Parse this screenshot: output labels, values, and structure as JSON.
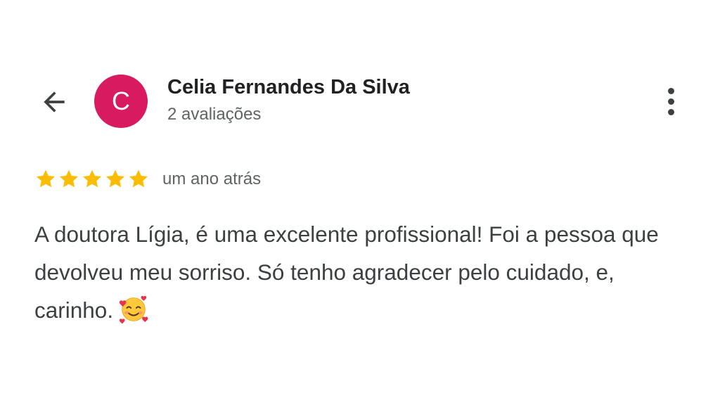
{
  "header": {
    "back_icon": "arrow-left-icon",
    "more_icon": "more-vert-icon"
  },
  "reviewer": {
    "avatar_letter": "C",
    "avatar_color": "#D81B60",
    "name": "Celia Fernandes Da Silva",
    "review_count": "2 avaliações"
  },
  "review": {
    "rating": 5,
    "max_rating": 5,
    "star_color": "#FBBC04",
    "time": "um ano atrás",
    "text": "A doutora Lígia, é uma excelente profissional! Foi a pessoa que devolveu meu sorriso. Só tenho agradecer pelo cuidado, e, carinho.",
    "emoji_icon": "smiling-face-with-hearts-icon"
  }
}
